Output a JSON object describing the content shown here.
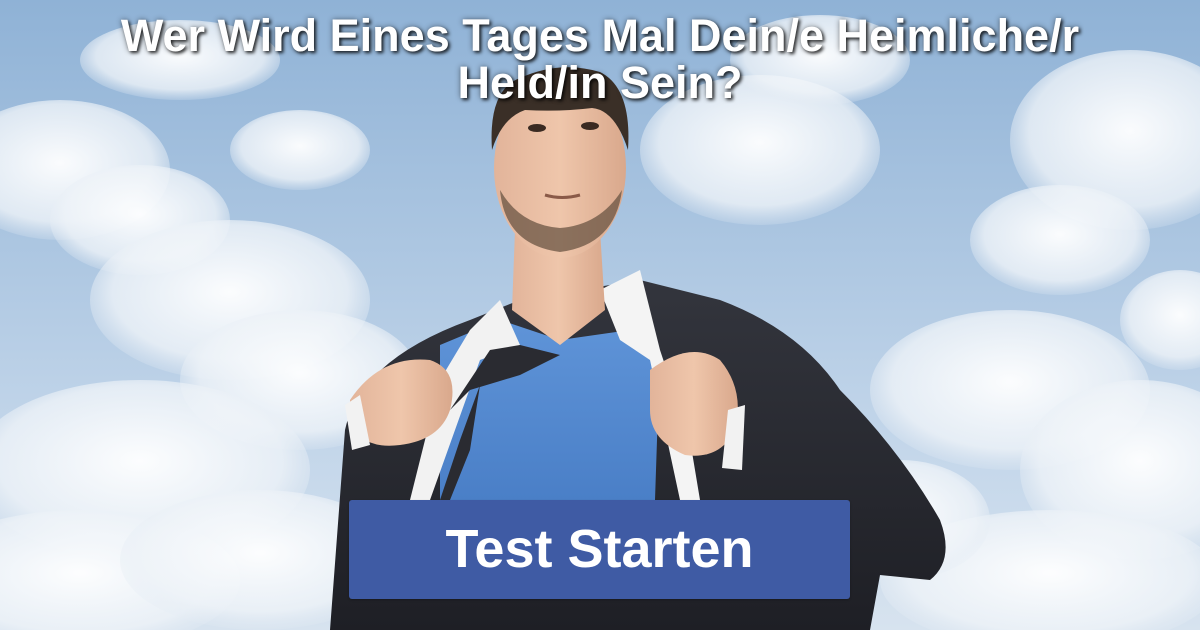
{
  "headline": {
    "line1": "Wer Wird Eines Tages Mal Dein/e Heimliche/r",
    "line2": "Held/in Sein?"
  },
  "cta": {
    "label": "Test Starten"
  },
  "colors": {
    "button": "#3f5ba4",
    "headline_text": "#ffffff",
    "sky": "#a9c4e0"
  },
  "image": {
    "subject": "man-opening-shirt-icon"
  }
}
